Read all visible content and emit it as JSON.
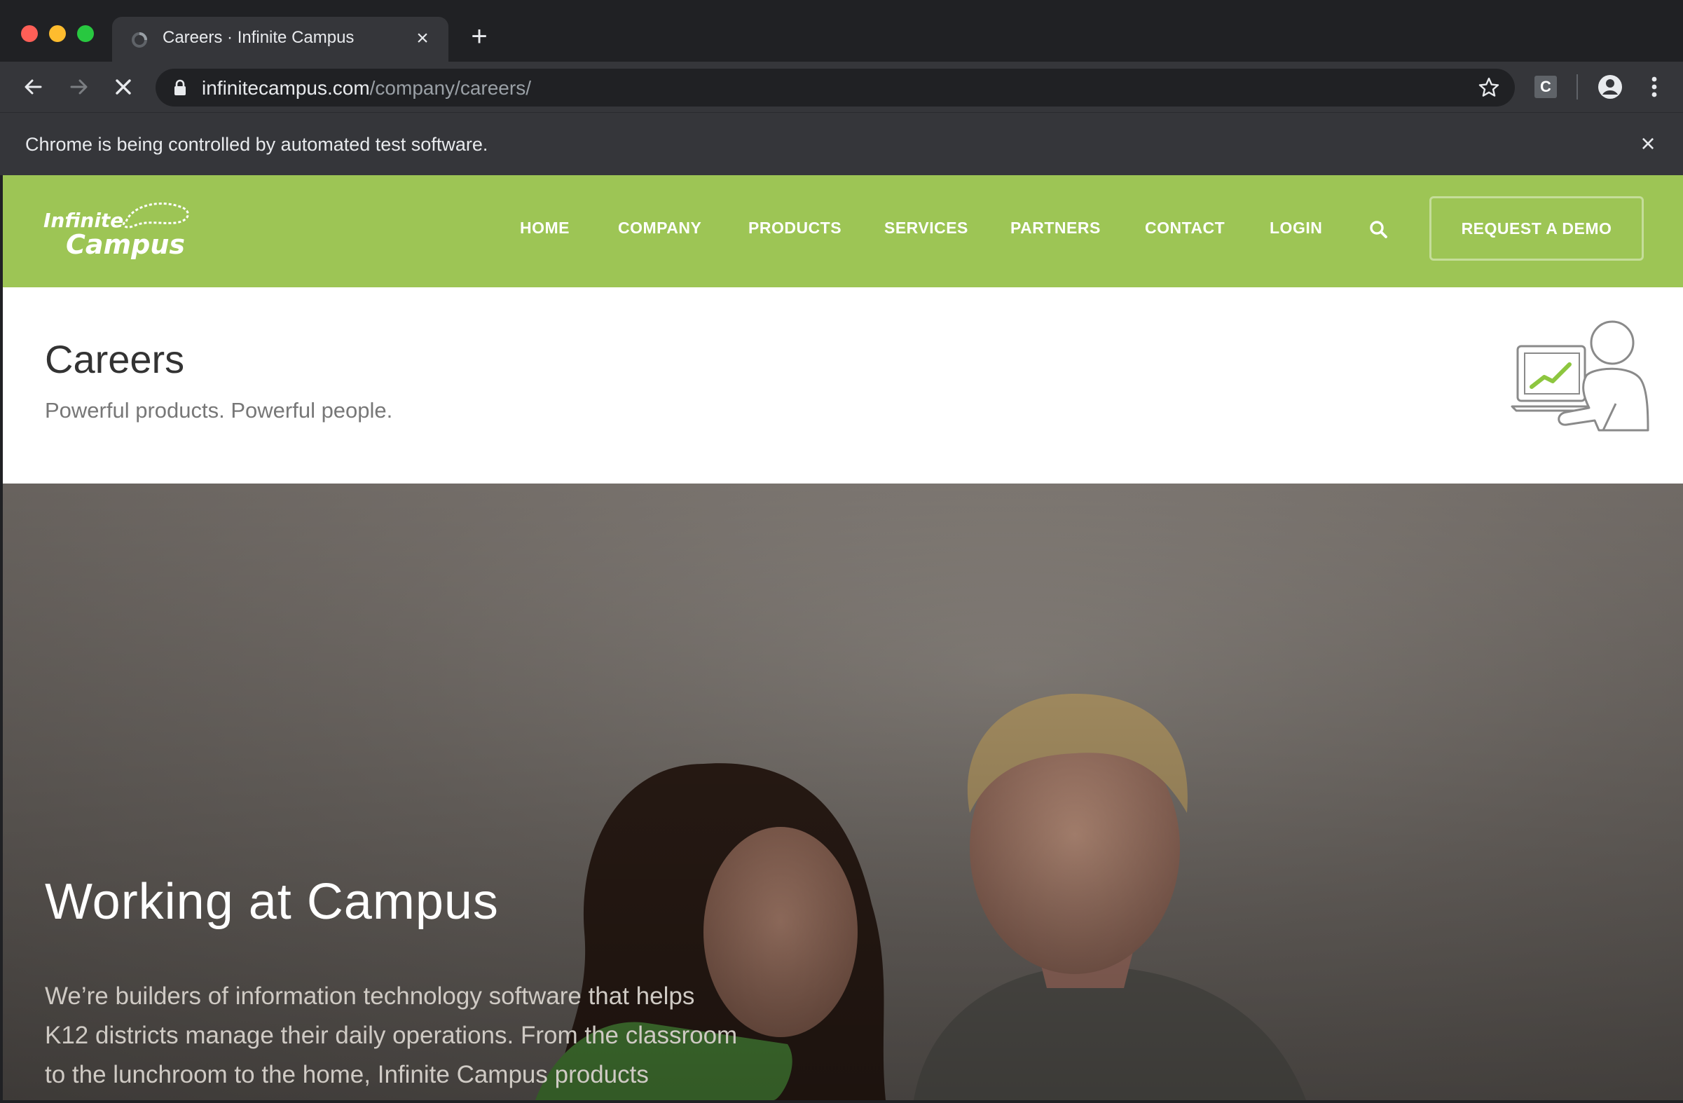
{
  "browser": {
    "tab": {
      "title": "Careers · Infinite Campus"
    },
    "url": {
      "host": "infinitecampus.com",
      "path": "/company/careers/"
    },
    "extension_letter": "C",
    "infobar": {
      "text": "Chrome is being controlled by automated test software."
    },
    "icons": [
      "back-icon",
      "forward-icon",
      "stop-icon",
      "lock-icon",
      "star-icon",
      "profile-icon",
      "menu-icon",
      "close-icon",
      "new-tab-icon"
    ]
  },
  "site": {
    "logo": {
      "line1": "Infinite",
      "line2": "Campus"
    },
    "nav": [
      "HOME",
      "COMPANY",
      "PRODUCTS",
      "SERVICES",
      "PARTNERS",
      "CONTACT",
      "LOGIN"
    ],
    "cta": "REQUEST A DEMO",
    "brand_color": "#9dc555"
  },
  "careers": {
    "title": "Careers",
    "subtitle": "Powerful products. Powerful people."
  },
  "hero": {
    "title": "Working at Campus",
    "body_lines": [
      "We’re builders of information technology software that helps",
      "K12 districts manage their daily operations. From the classroom",
      "to the lunchroom to the home, Infinite Campus products"
    ]
  }
}
